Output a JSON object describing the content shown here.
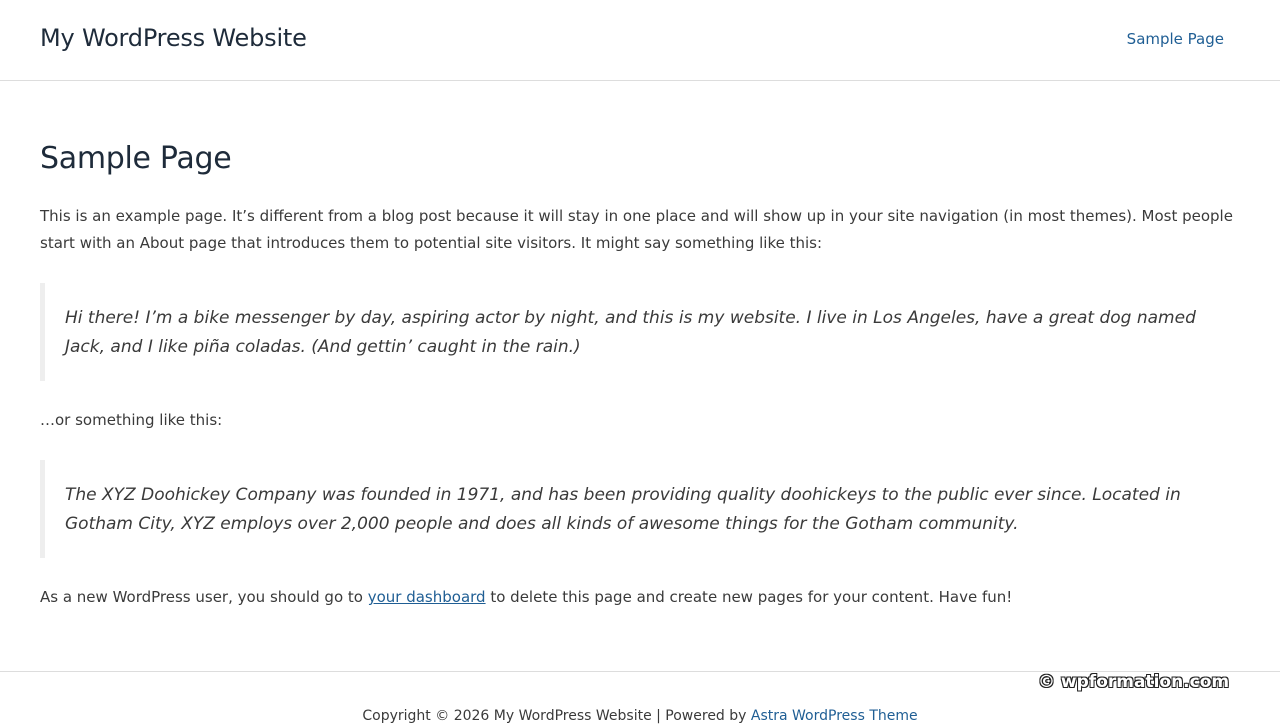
{
  "header": {
    "site_title": "My WordPress Website",
    "nav_link": "Sample Page"
  },
  "colors": {
    "link": "#1f5e94",
    "heading": "#1e2b3a",
    "text": "#3a3a3a",
    "border": "#dddddd"
  },
  "page": {
    "title": "Sample Page",
    "intro": "This is an example page. It’s different from a blog post because it will stay in one place and will show up in your site navigation (in most themes). Most people start with an About page that introduces them to potential site visitors. It might say something like this:",
    "quote1": "Hi there! I’m a bike messenger by day, aspiring actor by night, and this is my website. I live in Los Angeles, have a great dog named Jack, and I like piña coladas. (And gettin’ caught in the rain.)",
    "middle": "…or something like this:",
    "quote2": "The XYZ Doohickey Company was founded in 1971, and has been providing quality doohickeys to the public ever since. Located in Gotham City, XYZ employs over 2,000 people and does all kinds of awesome things for the Gotham community.",
    "outro_before": "As a new WordPress user, you should go to ",
    "outro_link": "your dashboard",
    "outro_after": " to delete this page and create new pages for your content. Have fun!"
  },
  "footer": {
    "copyright": "Copyright © 2026 My WordPress Website | Powered by ",
    "theme_link": "Astra WordPress Theme"
  },
  "watermark": "© wpformation.com"
}
